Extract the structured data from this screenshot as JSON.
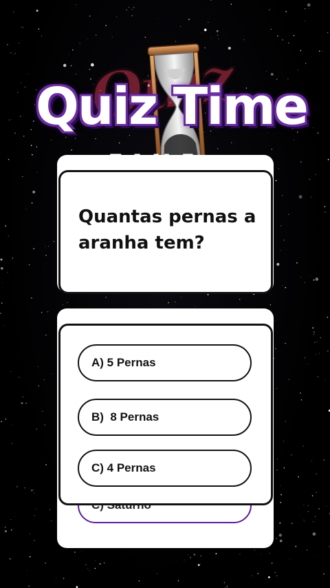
{
  "logo": {
    "title": "Quiz Time",
    "shadow_text": "Quiz",
    "subtitle": "TIME",
    "hourglass_icon": "hourglass-icon"
  },
  "question": {
    "text": "Quantas pernas a aranha tem?"
  },
  "options": [
    {
      "label": "A) 5 Pernas"
    },
    {
      "label": "B)  8 Pernas"
    },
    {
      "label": "C) 4 Pernas"
    }
  ],
  "ghost_option": {
    "label": "C) Saturno"
  },
  "colors": {
    "background": "#000000",
    "card": "#ffffff",
    "accent": "#6a2ca0",
    "ghost_border": "#5b1a9a"
  }
}
